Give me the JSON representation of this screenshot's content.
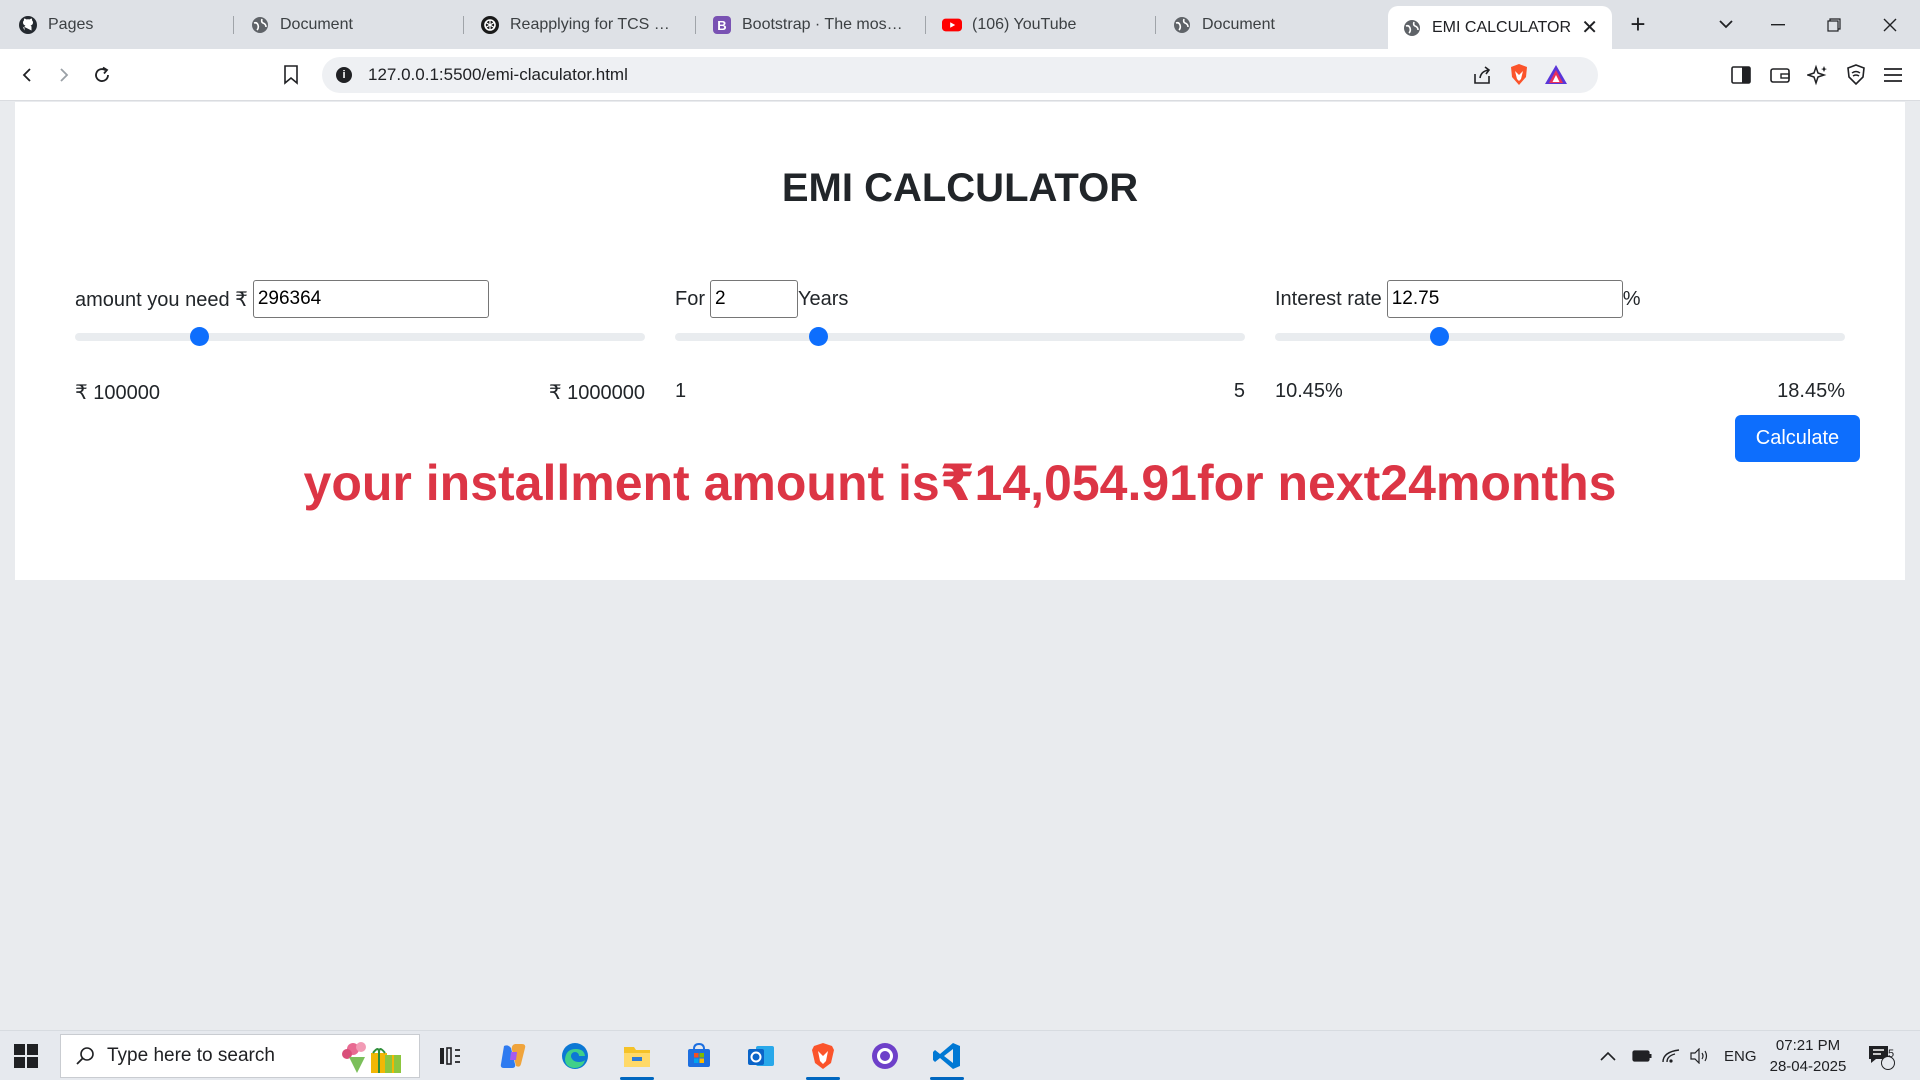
{
  "browser": {
    "tabs": [
      {
        "label": "Pages",
        "icon": "github-icon"
      },
      {
        "label": "Document",
        "icon": "globe-icon"
      },
      {
        "label": "Reapplying for TCS Ignite",
        "icon": "chatgpt-icon"
      },
      {
        "label": "Bootstrap · The most pop",
        "icon": "bootstrap-icon"
      },
      {
        "label": "(106) YouTube",
        "icon": "youtube-icon"
      },
      {
        "label": "Document",
        "icon": "globe-icon"
      },
      {
        "label": "EMI CALCULATOR",
        "icon": "globe-icon",
        "active": true
      }
    ],
    "url": "127.0.0.1:5500/emi-claculator.html"
  },
  "page": {
    "title": "EMI CALCULATOR",
    "amount": {
      "label": "amount you need ₹",
      "value": "296364",
      "min_label": "₹ 100000",
      "max_label": "₹ 1000000",
      "slider_fraction": 0.218
    },
    "years": {
      "label": "For",
      "value": "2",
      "suffix": "Years",
      "min_label": "1",
      "max_label": "5",
      "slider_fraction": 0.25
    },
    "interest": {
      "label": "Interest rate",
      "value": "12.75",
      "suffix": "%",
      "min_label": "10.45%",
      "max_label": "18.45%",
      "slider_fraction": 0.2875
    },
    "calculate_label": "Calculate",
    "result_text": "your installment amount is₹14,054.91for next24months"
  },
  "taskbar": {
    "search_placeholder": "Type here to search",
    "language": "ENG",
    "time": "07:21 PM",
    "date": "28-04-2025",
    "notification_count": "5"
  },
  "colors": {
    "primary": "#0d6efd",
    "danger": "#dc3545"
  }
}
